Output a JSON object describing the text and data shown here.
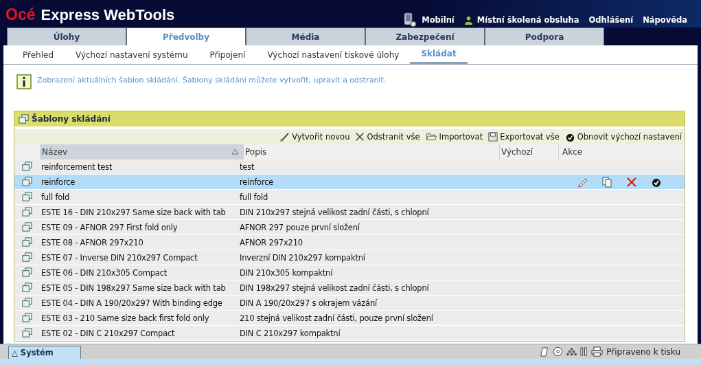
{
  "header": {
    "logo_brand": "Océ",
    "logo_product": "Express WebTools",
    "links": [
      {
        "label": "Mobilní",
        "kind": "mobile"
      },
      {
        "label": "Místní školená obsluha",
        "kind": "user"
      },
      {
        "label": "Odhlášení"
      },
      {
        "label": "Nápověda"
      }
    ]
  },
  "tabs": [
    {
      "label": "Úlohy",
      "selected": false
    },
    {
      "label": "Předvolby",
      "selected": true
    },
    {
      "label": "Média",
      "selected": false
    },
    {
      "label": "Zabezpečení",
      "selected": false
    },
    {
      "label": "Podpora",
      "selected": false
    }
  ],
  "subtabs": [
    {
      "label": "Přehled",
      "selected": false
    },
    {
      "label": "Výchozí nastavení systému",
      "selected": false
    },
    {
      "label": "Připojení",
      "selected": false
    },
    {
      "label": "Výchozí nastavení tiskové úlohy",
      "selected": false
    },
    {
      "label": "Skládat",
      "selected": true
    }
  ],
  "info": "Zobrazení aktuálních šablon skládání. Šablony skládání můžete vytvořit, upravit a odstranit.",
  "panel": {
    "title": "Šablony skládání",
    "toolbar": [
      {
        "label": "Vytvořit novou",
        "kind": "new"
      },
      {
        "label": "Odstranit vše",
        "kind": "delete"
      },
      {
        "label": "Importovat",
        "kind": "import"
      },
      {
        "label": "Exportovat vše",
        "kind": "export"
      },
      {
        "label": "Obnovit výchozí nastavení",
        "kind": "restore"
      }
    ],
    "columns": [
      "Název",
      "Popis",
      "Výchozí",
      "Akce"
    ],
    "rows": [
      {
        "name": "reinforcement test",
        "description": "test",
        "selected": false
      },
      {
        "name": "reinforce",
        "description": "reinforce",
        "selected": true
      },
      {
        "name": "full fold",
        "description": "full fold",
        "selected": false
      },
      {
        "name": "ESTE 16 - DIN 210x297 Same size back with tab",
        "description": "DIN 210x297 stejná velikost zadní části, s chlopní",
        "selected": false
      },
      {
        "name": "ESTE 09 - AFNOR 297 First fold only",
        "description": "AFNOR 297 pouze první složení",
        "selected": false
      },
      {
        "name": "ESTE 08 - AFNOR 297x210",
        "description": "AFNOR 297x210",
        "selected": false
      },
      {
        "name": "ESTE 07 - Inverse DIN 210x297 Compact",
        "description": "Inverzní DIN 210x297 kompaktní",
        "selected": false
      },
      {
        "name": "ESTE 06 - DIN 210x305 Compact",
        "description": "DIN 210x305 kompaktní",
        "selected": false
      },
      {
        "name": "ESTE 05 - DIN 198x297 Same size back with tab",
        "description": "DIN 198x297 stejná velikost zadní části, s chlopní",
        "selected": false
      },
      {
        "name": "ESTE 04 - DIN A 190/20x297 With binding edge",
        "description": "DIN A 190/20x297 s okrajem vázání",
        "selected": false
      },
      {
        "name": "ESTE 03 - 210 Same size back first fold only",
        "description": "210 stejná velikost zadní části, pouze první složení",
        "selected": false
      },
      {
        "name": "ESTE 02 - DIN C 210x297 Compact",
        "description": "DIN C 210x297 kompaktní",
        "selected": false
      }
    ]
  },
  "status_bar": {
    "system_tab": "Systém",
    "arrow": "△",
    "status": "Připraveno k tisku"
  }
}
